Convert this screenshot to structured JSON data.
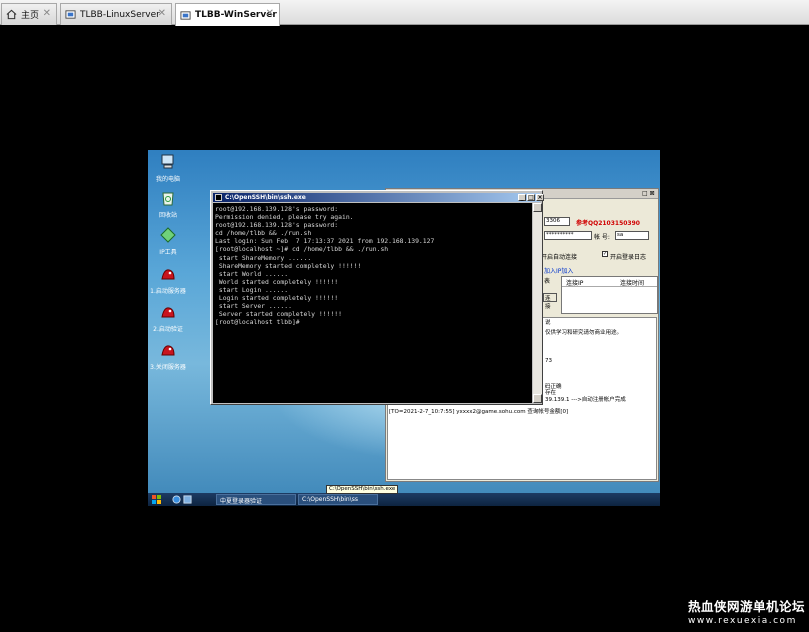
{
  "tabs": [
    {
      "label": "主页",
      "icon": "home-icon",
      "active": false
    },
    {
      "label": "TLBB-LinuxServer",
      "icon": "vm-icon",
      "active": false
    },
    {
      "label": "TLBB-WinServer",
      "icon": "vm-icon",
      "active": true
    }
  ],
  "desktop": {
    "icons": [
      {
        "label": "我的电脑",
        "icon": "computer-icon"
      },
      {
        "label": "回收站",
        "icon": "recycle-bin-icon"
      },
      {
        "label": "IP工具",
        "icon": "network-tool-icon"
      },
      {
        "label": "1.启动服务器",
        "icon": "server-start-icon"
      },
      {
        "label": "2.启动验证",
        "icon": "auth-start-icon"
      },
      {
        "label": "3.关闭服务器",
        "icon": "server-stop-icon"
      }
    ]
  },
  "cmd": {
    "title": "C:\\OpenSSH\\bin\\ssh.exe",
    "lines": [
      "root@192.168.139.128's password:",
      "Permission denied, please try again.",
      "root@192.168.139.128's password:",
      "cd /home/tlbb && ./run.sh",
      "Last login: Sun Feb  7 17:13:37 2021 from 192.168.139.127",
      "[root@localhost ~]# cd /home/tlbb && ./run.sh",
      " start ShareMemory ......",
      " ShareMemory started completely !!!!!!",
      " start World ......",
      " World started completely !!!!!!",
      " start Login ......",
      " Login started completely !!!!!!",
      " start Server ......",
      " Server started completely !!!!!!",
      "[root@localhost tlbb]#"
    ]
  },
  "bgwin": {
    "port_value": "3306",
    "red_text": "参考QQ2103150390",
    "password_value": "**********",
    "account_label": "帐 号:",
    "account_value": "sa",
    "autoconnect_label": "开启自动连接",
    "login_log_label": "开启登录日志",
    "ip_add_label": "加入IP加入",
    "ip_list_label": "表",
    "connect_button": "连接",
    "col_ip": "连接IP",
    "col_time": "连接时间",
    "log_lines": [
      "说",
      "仅供学习和研究请勿商业用途。",
      "73",
      "码正确",
      "存在",
      "39.139.1 --->自动注册帐户完成",
      "[TO=2021-2-7_10:7:55] yxxxx2@game.sohu.com 查询帐号金额[0]"
    ],
    "red_color": "#d00000"
  },
  "taskbar": {
    "items": [
      "中夏登录器验证",
      "C:\\OpenSSH\\bin\\ss"
    ],
    "tooltip": "C:\\OpenSSH\\bin\\ssh.exe"
  },
  "watermark": {
    "line1": "热血侠网游单机论坛",
    "line2": "www.rexuexia.com"
  }
}
